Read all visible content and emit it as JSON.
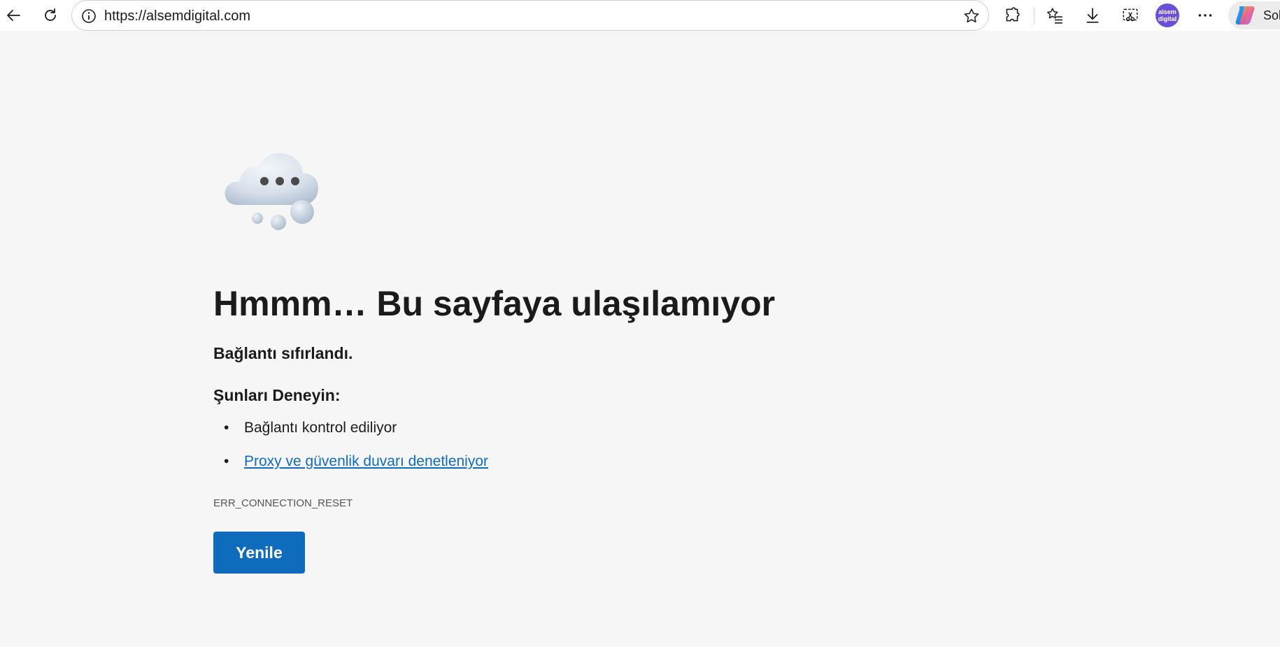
{
  "browser": {
    "url": "https://alsemdigital.com",
    "avatar_text": "alsem digital",
    "copilot_label": "Sol",
    "icons": {
      "back": "back-arrow-icon",
      "refresh": "refresh-icon",
      "site_info": "info-icon",
      "favorite": "star-icon",
      "extensions": "puzzle-icon",
      "favorites": "favorites-list-icon",
      "downloads": "download-icon",
      "screenshot": "screenshot-icon",
      "more": "more-dots-icon",
      "copilot": "copilot-icon"
    }
  },
  "error_page": {
    "illustration": "cloud-icon",
    "heading": "Hmmm… Bu sayfaya ulaşılamıyor",
    "subtitle": "Bağlantı sıfırlandı.",
    "try_heading": "Şunları Deneyin:",
    "suggestions": [
      "Bağlantı kontrol ediliyor",
      "Proxy ve güvenlik duvarı denetleniyor"
    ],
    "error_code": "ERR_CONNECTION_RESET",
    "reload_label": "Yenile"
  },
  "colors": {
    "page_background": "#f6f6f6",
    "accent": "#0f6cbd",
    "avatar": "#6b4fd8"
  }
}
